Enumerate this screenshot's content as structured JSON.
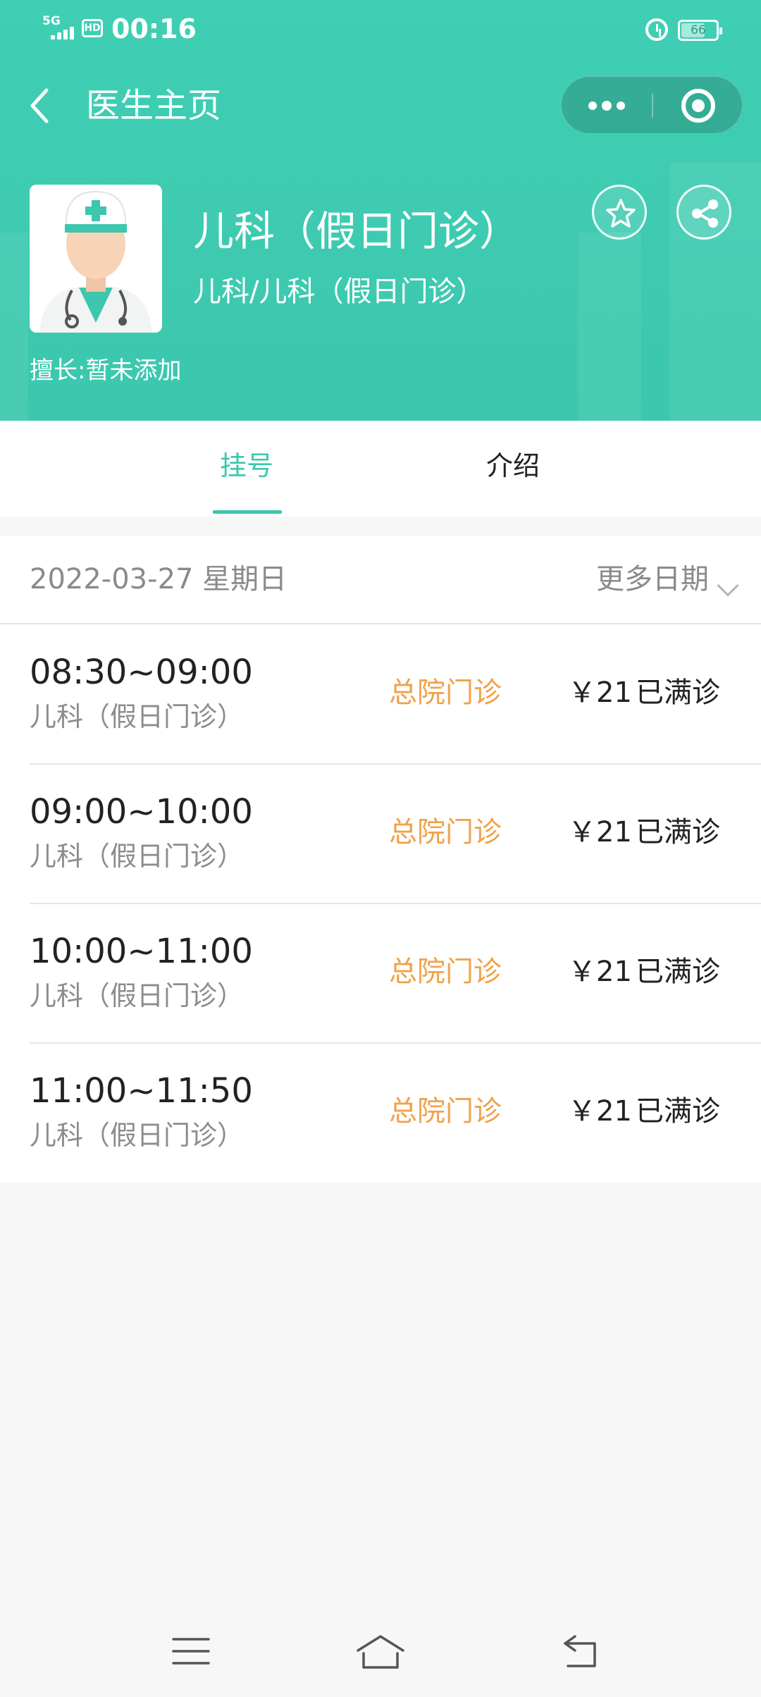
{
  "status_bar": {
    "network": "5G",
    "hd": "HD",
    "time": "00:16",
    "battery": "66",
    "battery_level": 0.66
  },
  "nav": {
    "title": "医生主页"
  },
  "doctor": {
    "name": "儿科（假日门诊）",
    "department": "儿科/儿科（假日门诊）",
    "specialty": "擅长:暂未添加"
  },
  "tabs": [
    {
      "label": "挂号",
      "active": true
    },
    {
      "label": "介绍",
      "active": false
    }
  ],
  "schedule": {
    "date": "2022-03-27 星期日",
    "more_dates": "更多日期",
    "slots": [
      {
        "time": "08:30~09:00",
        "dept": "儿科（假日门诊）",
        "location": "总院门诊",
        "price": "￥21",
        "status": "已满诊"
      },
      {
        "time": "09:00~10:00",
        "dept": "儿科（假日门诊）",
        "location": "总院门诊",
        "price": "￥21",
        "status": "已满诊"
      },
      {
        "time": "10:00~11:00",
        "dept": "儿科（假日门诊）",
        "location": "总院门诊",
        "price": "￥21",
        "status": "已满诊"
      },
      {
        "time": "11:00~11:50",
        "dept": "儿科（假日门诊）",
        "location": "总院门诊",
        "price": "￥21",
        "status": "已满诊"
      }
    ]
  },
  "colors": {
    "primary": "#3cc7ae",
    "location": "#f0a24a",
    "text": "#222222",
    "muted": "#8c8c8c"
  },
  "icons": {
    "back": "chevron-left-icon",
    "more": "more-dots-icon",
    "close": "target-circle-icon",
    "favorite": "star-icon",
    "share": "share-icon",
    "menu": "hamburger-menu-icon",
    "home": "home-icon",
    "return": "return-arrow-icon"
  }
}
